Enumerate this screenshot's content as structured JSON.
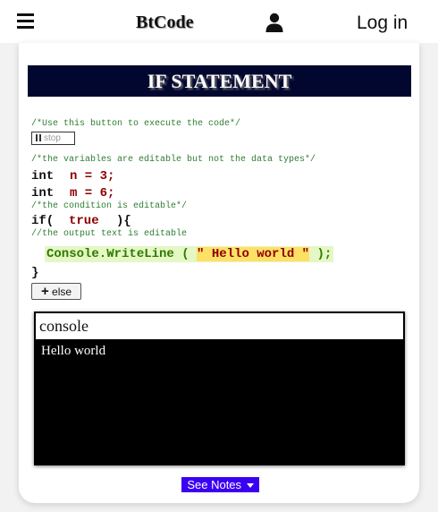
{
  "nav": {
    "brand": "BtCode",
    "login_label": "Log in"
  },
  "lesson": {
    "title": "IF STATEMENT"
  },
  "code": {
    "comment_run": "/*Use this button to execute the code*/",
    "stop_label": "stop",
    "comment_vars": "/*the variables are editable but not the data types*/",
    "var_n_type": "int",
    "var_n_expr": "n = 3;",
    "var_m_type": "int",
    "var_m_expr": "m = 6;",
    "comment_condition": "/*the condition is editable*/",
    "if_open": "if(",
    "condition": "true",
    "if_close": "){",
    "comment_output": "//the output text is editable",
    "write_pre": "Console.WriteLine ( ",
    "write_string": "\" Hello world \"",
    "write_post": " );",
    "close_brace": "}",
    "else_icon": "+",
    "else_label": "else"
  },
  "console": {
    "header": "console",
    "output": "Hello world"
  },
  "notes": {
    "label": "See Notes"
  },
  "icons": {
    "menu": "hamburger-menu-icon",
    "user": "user-icon",
    "pause": "pause-icon",
    "caret": "caret-down-icon"
  },
  "colors": {
    "banner_bg": "#02072f",
    "notes_bg": "#3b00f2",
    "comment": "#2e7d32",
    "variable": "#8b0000",
    "method": "#2f7a00",
    "string_highlight": "#ffe066"
  }
}
